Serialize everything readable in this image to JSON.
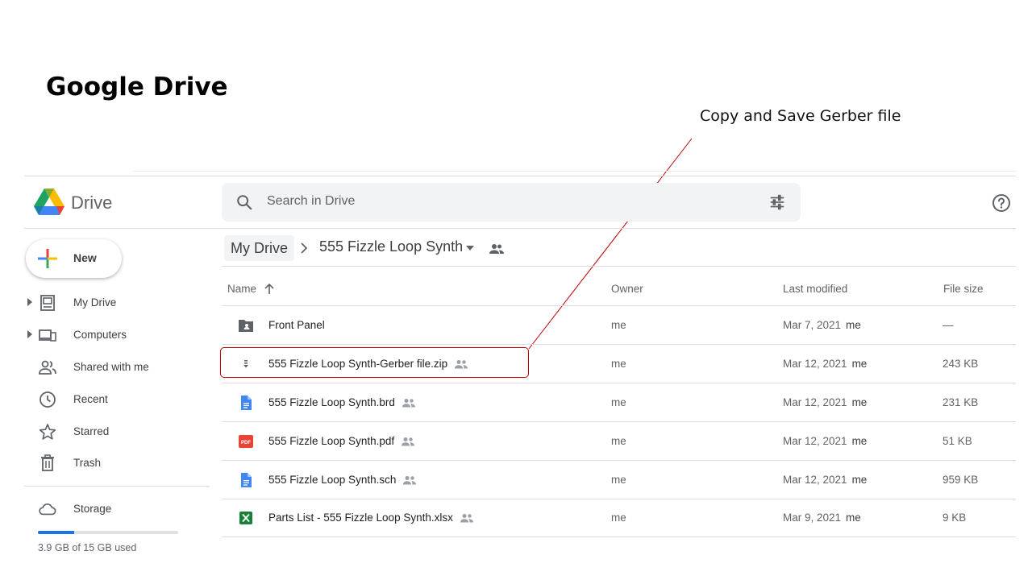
{
  "slide": {
    "title": "Google Drive",
    "callout": "Copy and Save Gerber file"
  },
  "header": {
    "brand": "Drive",
    "search_placeholder": "Search in Drive"
  },
  "sidebar": {
    "new_label": "New",
    "items": [
      {
        "label": "My Drive",
        "icon": "my-drive-icon"
      },
      {
        "label": "Computers",
        "icon": "computers-icon"
      },
      {
        "label": "Shared with me",
        "icon": "shared-icon"
      },
      {
        "label": "Recent",
        "icon": "clock-icon"
      },
      {
        "label": "Starred",
        "icon": "star-icon"
      },
      {
        "label": "Trash",
        "icon": "trash-icon"
      }
    ],
    "storage": {
      "label": "Storage",
      "used_text": "3.9 GB of 15 GB used",
      "used_fraction": 0.26
    }
  },
  "breadcrumb": {
    "root": "My Drive",
    "current": "555 Fizzle Loop Synth"
  },
  "table": {
    "columns": {
      "name": "Name",
      "owner": "Owner",
      "modified": "Last modified",
      "size": "File size"
    },
    "rows": [
      {
        "name": "Front Panel",
        "type": "shared-folder",
        "shared": false,
        "owner": "me",
        "modified": "Mar 7, 2021",
        "modified_by": "me",
        "size": "—"
      },
      {
        "name": "555 Fizzle Loop Synth-Gerber file.zip",
        "type": "zip",
        "shared": true,
        "owner": "me",
        "modified": "Mar 12, 2021",
        "modified_by": "me",
        "size": "243 KB"
      },
      {
        "name": "555 Fizzle Loop Synth.brd",
        "type": "doc",
        "shared": true,
        "owner": "me",
        "modified": "Mar 12, 2021",
        "modified_by": "me",
        "size": "231 KB"
      },
      {
        "name": "555 Fizzle Loop Synth.pdf",
        "type": "pdf",
        "shared": true,
        "owner": "me",
        "modified": "Mar 12, 2021",
        "modified_by": "me",
        "size": "51 KB"
      },
      {
        "name": "555 Fizzle Loop Synth.sch",
        "type": "doc",
        "shared": true,
        "owner": "me",
        "modified": "Mar 12, 2021",
        "modified_by": "me",
        "size": "959 KB"
      },
      {
        "name": "Parts List - 555 Fizzle Loop Synth.xlsx",
        "type": "sheet",
        "shared": true,
        "owner": "me",
        "modified": "Mar 9, 2021",
        "modified_by": "me",
        "size": "9 KB"
      }
    ]
  },
  "colors": {
    "accent": "#1a73e8",
    "callout": "#c00000",
    "pdf": "#ea4335",
    "sheet": "#188038"
  }
}
